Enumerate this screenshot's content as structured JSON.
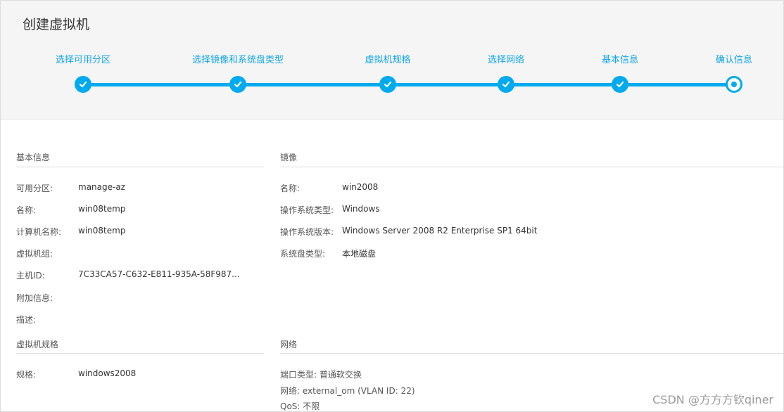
{
  "title": "创建虚拟机",
  "steps": [
    {
      "label": "选择可用分区",
      "status": "done"
    },
    {
      "label": "选择镜像和系统盘类型",
      "status": "done"
    },
    {
      "label": "虚拟机规格",
      "status": "done"
    },
    {
      "label": "选择网络",
      "status": "done"
    },
    {
      "label": "基本信息",
      "status": "done"
    },
    {
      "label": "确认信息",
      "status": "current"
    }
  ],
  "basic_info": {
    "heading": "基本信息",
    "rows": [
      {
        "label": "可用分区:",
        "value": "manage-az"
      },
      {
        "label": "名称:",
        "value": "win08temp"
      },
      {
        "label": "计算机名称:",
        "value": "win08temp"
      },
      {
        "label": "虚拟机组:",
        "value": ""
      },
      {
        "label": "主机ID:",
        "value": "7C33CA57-C632-E811-935A-58F987..."
      },
      {
        "label": "附加信息:",
        "value": ""
      },
      {
        "label": "描述:",
        "value": ""
      }
    ]
  },
  "image": {
    "heading": "镜像",
    "rows": [
      {
        "label": "名称:",
        "value": "win2008"
      },
      {
        "label": "操作系统类型:",
        "value": "Windows"
      },
      {
        "label": "操作系统版本:",
        "value": "Windows Server 2008 R2 Enterprise SP1 64bit"
      },
      {
        "label": "系统盘类型:",
        "value": "本地磁盘"
      }
    ]
  },
  "vm_spec": {
    "heading": "虚拟机规格",
    "rows": [
      {
        "label": "规格:",
        "value": "windows2008"
      }
    ]
  },
  "network": {
    "heading": "网络",
    "lines": [
      "端口类型: 普通软交换",
      "网络: external_om (VLAN ID: 22)",
      "QoS: 不限"
    ]
  },
  "watermark": "CSDN @方方方钦qiner",
  "colors": {
    "accent": "#00aaef",
    "step_text": "#11a5e3",
    "header_bg": "#f5f5f5"
  }
}
